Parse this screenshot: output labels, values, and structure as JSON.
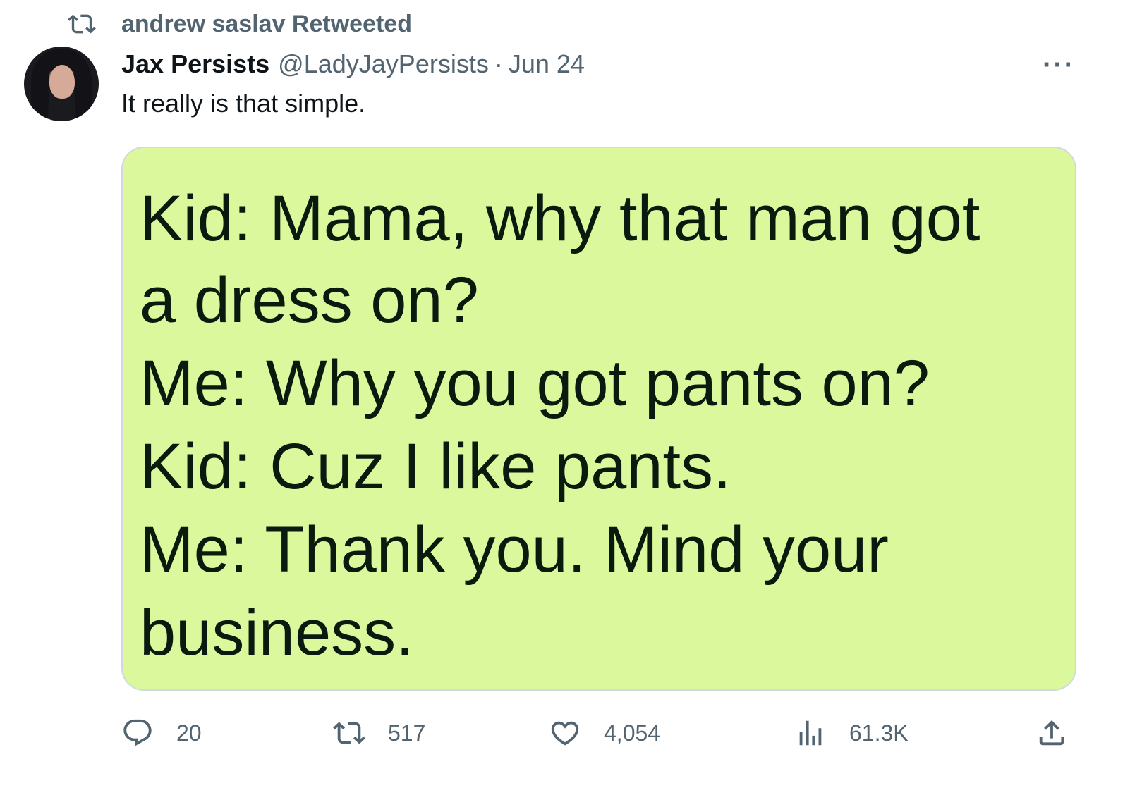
{
  "retweet": {
    "icon": "retweet-icon",
    "label": "andrew saslav Retweeted"
  },
  "tweet": {
    "display_name": "Jax Persists",
    "handle": "@LadyJayPersists",
    "separator": "·",
    "date": "Jun 24",
    "more_icon": "more-icon",
    "more_label": "···",
    "text": "It really is that simple."
  },
  "media": {
    "background": "#dcf89c",
    "lines": [
      "Kid: Mama, why that man got",
      "a dress on?",
      "Me: Why you got pants on?",
      "Kid: Cuz I like pants.",
      "Me: Thank you. Mind your",
      "business."
    ]
  },
  "actions": {
    "reply": {
      "icon": "reply-icon",
      "count": "20"
    },
    "retweet": {
      "icon": "retweet-icon",
      "count": "517"
    },
    "like": {
      "icon": "heart-icon",
      "count": "4,054"
    },
    "views": {
      "icon": "analytics-icon",
      "count": "61.3K"
    },
    "share": {
      "icon": "share-icon"
    }
  },
  "colors": {
    "text_primary": "#0f1419",
    "text_secondary": "#536471",
    "border": "#cfd9de"
  }
}
